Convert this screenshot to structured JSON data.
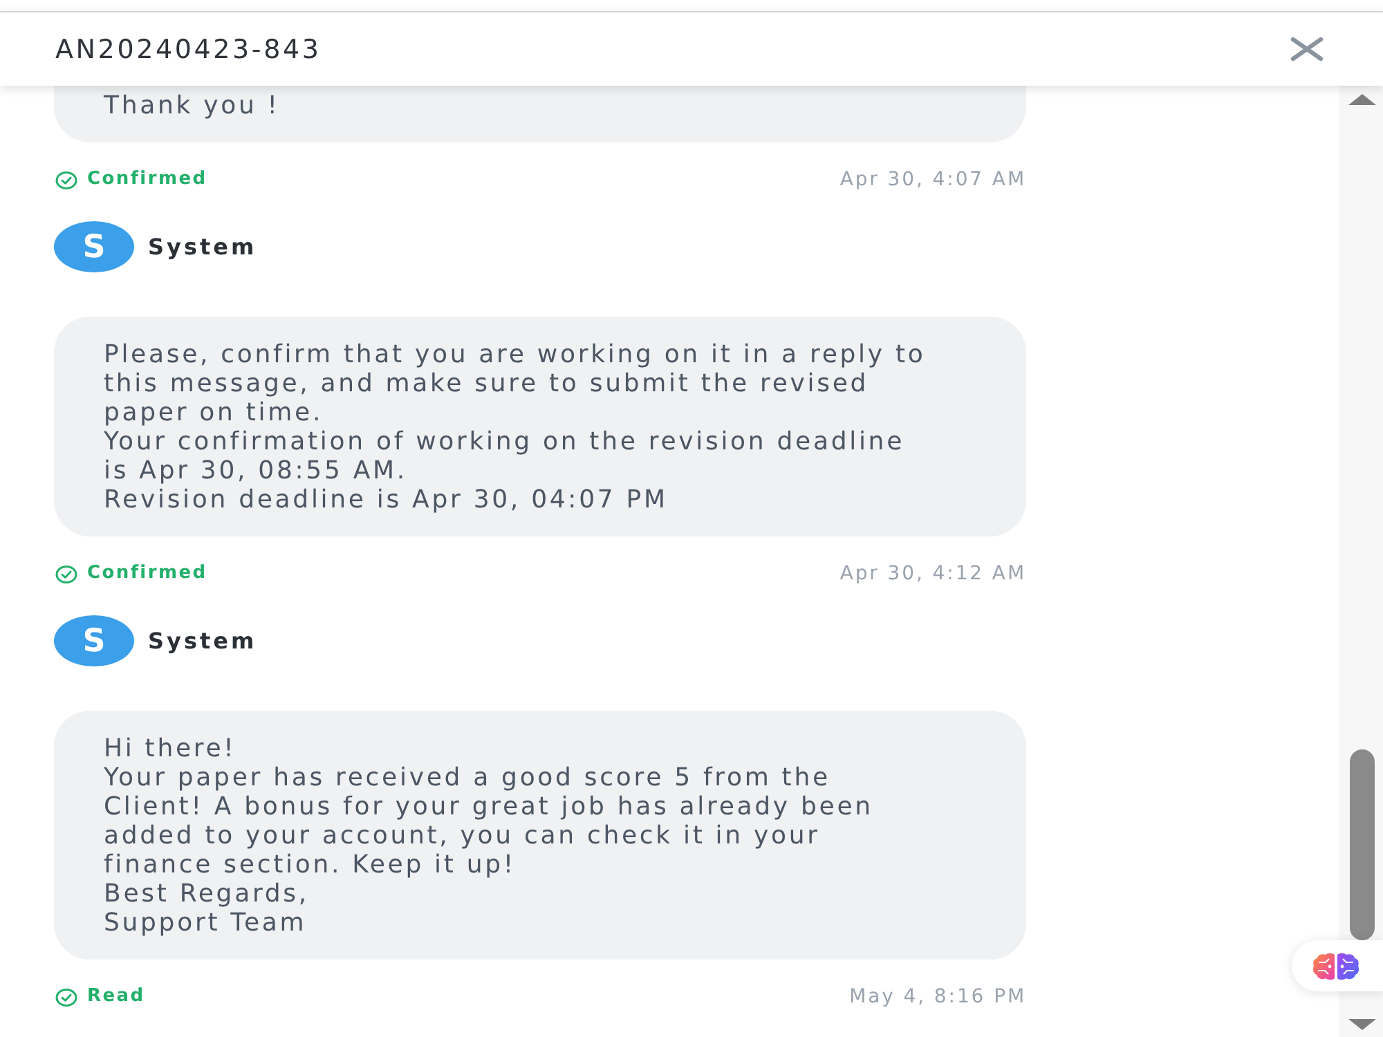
{
  "header": {
    "title": "AN20240423-843"
  },
  "messages": [
    {
      "text": "Thank you !",
      "status": "Confirmed",
      "time": "Apr 30, 4:07 AM"
    },
    {
      "sender": {
        "initial": "S",
        "name": "System"
      },
      "text": "Please, confirm that you are working on it in a reply to\nthis message, and make sure to submit the revised\npaper on time.\nYour confirmation of working on the revision deadline\nis Apr 30, 08:55 AM.\nRevision deadline is Apr 30, 04:07 PM",
      "status": "Confirmed",
      "time": "Apr 30, 4:12 AM"
    },
    {
      "sender": {
        "initial": "S",
        "name": "System"
      },
      "text": "Hi there!\nYour paper has received a good score 5 from the\nClient! A bonus for your great job has already been\nadded to your account, you can check it in your\nfinance section. Keep it up!\nBest Regards,\nSupport Team",
      "status": "Read",
      "time": "May 4, 8:16 PM"
    }
  ]
}
